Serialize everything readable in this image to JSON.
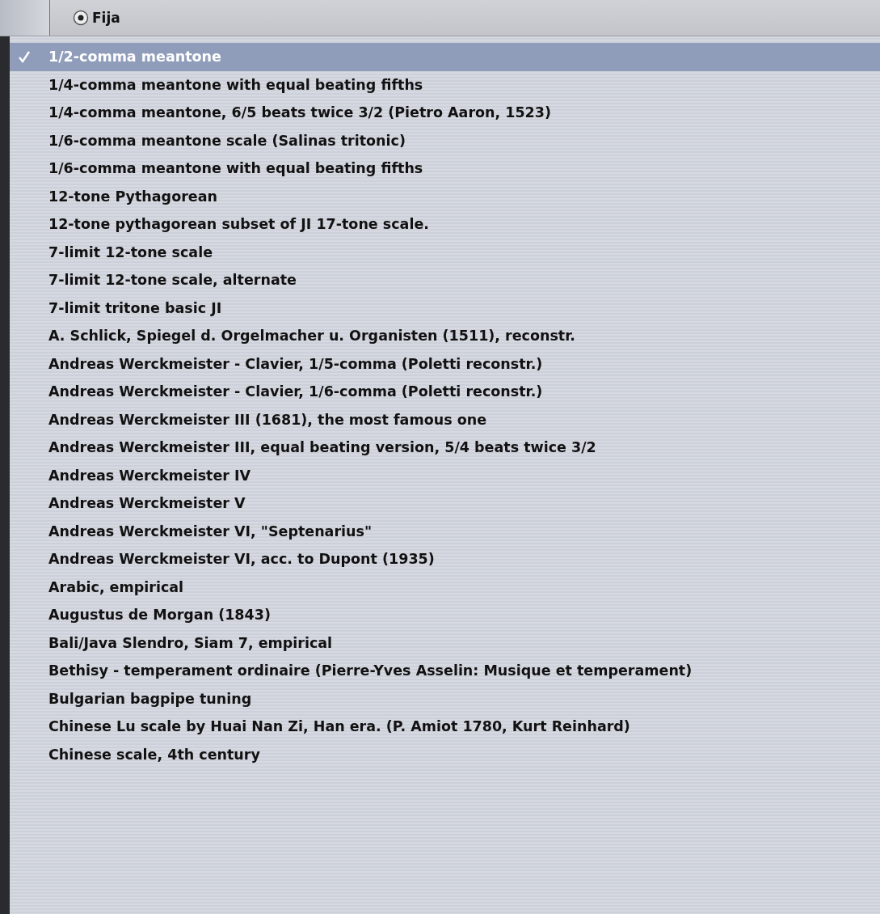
{
  "mode_radio": {
    "label": "Fija",
    "selected": true
  },
  "menu": {
    "items": [
      {
        "label": "1/2-comma meantone",
        "selected": true
      },
      {
        "label": "1/4-comma meantone with equal beating fifths",
        "selected": false
      },
      {
        "label": "1/4-comma meantone, 6/5 beats twice 3/2 (Pietro Aaron, 1523)",
        "selected": false
      },
      {
        "label": "1/6-comma meantone scale (Salinas tritonic)",
        "selected": false
      },
      {
        "label": "1/6-comma meantone with equal beating fifths",
        "selected": false
      },
      {
        "label": "12-tone Pythagorean",
        "selected": false
      },
      {
        "label": "12-tone pythagorean subset of JI 17-tone scale.",
        "selected": false
      },
      {
        "label": "7-limit 12-tone scale",
        "selected": false
      },
      {
        "label": "7-limit 12-tone scale, alternate",
        "selected": false
      },
      {
        "label": "7-limit tritone basic JI",
        "selected": false
      },
      {
        "label": "A. Schlick, Spiegel d. Orgelmacher u. Organisten (1511), reconstr.",
        "selected": false
      },
      {
        "label": "Andreas Werckmeister - Clavier, 1/5-comma (Poletti reconstr.)",
        "selected": false
      },
      {
        "label": "Andreas Werckmeister - Clavier, 1/6-comma (Poletti reconstr.)",
        "selected": false
      },
      {
        "label": "Andreas Werckmeister III (1681), the most famous one",
        "selected": false
      },
      {
        "label": "Andreas Werckmeister III, equal beating version, 5/4 beats twice 3/2",
        "selected": false
      },
      {
        "label": "Andreas Werckmeister IV",
        "selected": false
      },
      {
        "label": "Andreas Werckmeister V",
        "selected": false
      },
      {
        "label": "Andreas Werckmeister VI, \"Septenarius\"",
        "selected": false
      },
      {
        "label": "Andreas Werckmeister VI, acc. to Dupont (1935)",
        "selected": false
      },
      {
        "label": "Arabic, empirical",
        "selected": false
      },
      {
        "label": "Augustus de Morgan (1843)",
        "selected": false
      },
      {
        "label": "Bali/Java Slendro, Siam 7, empirical",
        "selected": false
      },
      {
        "label": "Bethisy - temperament ordinaire (Pierre-Yves Asselin: Musique et temperament)",
        "selected": false
      },
      {
        "label": "Bulgarian bagpipe tuning",
        "selected": false
      },
      {
        "label": "Chinese Lu scale by Huai Nan Zi, Han era. (P. Amiot 1780, Kurt Reinhard)",
        "selected": false
      },
      {
        "label": "Chinese scale, 4th century",
        "selected": false
      }
    ]
  }
}
